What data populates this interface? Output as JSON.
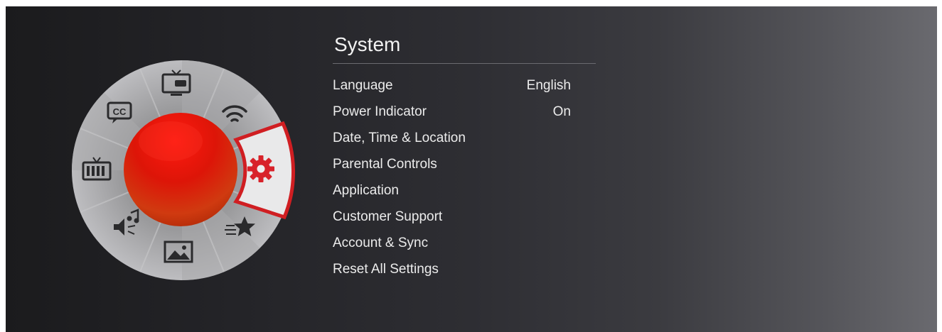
{
  "menu": {
    "title": "System",
    "items": [
      {
        "label": "Language",
        "value": "English"
      },
      {
        "label": "Power Indicator",
        "value": "On"
      },
      {
        "label": "Date, Time & Location",
        "value": ""
      },
      {
        "label": "Parental Controls",
        "value": ""
      },
      {
        "label": "Application",
        "value": ""
      },
      {
        "label": "Customer Support",
        "value": ""
      },
      {
        "label": "Account & Sync",
        "value": ""
      },
      {
        "label": "Reset All Settings",
        "value": ""
      }
    ]
  },
  "wheel": {
    "segments": [
      {
        "name": "tv-input-icon"
      },
      {
        "name": "wifi-icon"
      },
      {
        "name": "gear-icon",
        "selected": true
      },
      {
        "name": "star-icon"
      },
      {
        "name": "picture-icon"
      },
      {
        "name": "sound-icon"
      },
      {
        "name": "tv-channel-icon"
      },
      {
        "name": "cc-icon"
      }
    ],
    "accent_color": "#e01f26"
  }
}
